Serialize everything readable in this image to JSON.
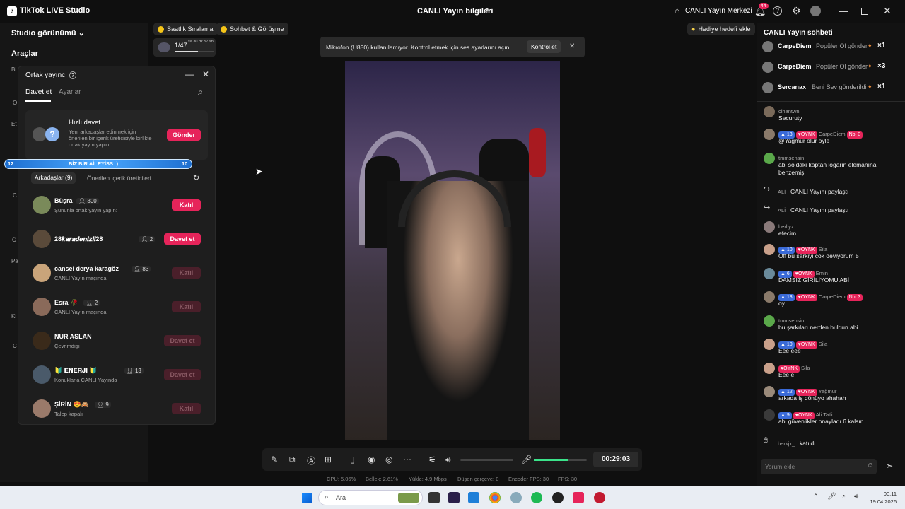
{
  "app": {
    "title": "TikTok LIVE Studio",
    "center_title": "CANLI Yayın bilgileri",
    "live_center": "CANLI Yayın Merkezi",
    "notif_count": "44"
  },
  "left": {
    "studio_view": "Studio görünümü",
    "tools": "Araçlar",
    "clipped_labels": [
      "Bi",
      "O",
      "Et",
      "C",
      "Ö",
      "Pa",
      "Ki",
      "C"
    ]
  },
  "top_pills": {
    "ranking": "Saatlik Sıralama",
    "chat_call": "Sohbet & Görüşme",
    "gift_goal": "Hediye hedefi ekle"
  },
  "goal_widget": {
    "progress_text": "1/47",
    "time_left": "sa 30 dk 57 sn",
    "progress_fraction": 0.6
  },
  "toast": {
    "message": "Mikrofon (U850) kullanılamıyor. Kontrol etmek için ses ayarlarını açın.",
    "button": "Kontrol et"
  },
  "modal": {
    "title": "Ortak yayıncı",
    "tabs": [
      "Davet et",
      "Ayarlar"
    ],
    "quick_invite": {
      "title": "Hızlı davet",
      "desc": "Yeni arkadaşlar edinmek için önerilen bir içerik üreticisiyle birlikte ortak yayın yapın",
      "button": "Gönder"
    },
    "banner": {
      "left": "12",
      "text": "BİZ BİR AİLEYİSS :)",
      "right": "10"
    },
    "subtabs": [
      "Arkadaşlar (9)",
      "Önerilen içerik üreticileri"
    ],
    "friends": [
      {
        "name": "Büşra",
        "count": "300",
        "sub": "Şununla ortak yayın yapın:",
        "button": "Katıl",
        "active": true
      },
      {
        "name": "28𝒌𝒂𝒓𝒂𝒅𝒆𝒏𝒊𝒛𝒍𝒊28",
        "count": "2",
        "sub": "",
        "button": "Davet et",
        "active": true
      },
      {
        "name": "cansel derya karagöz",
        "count": "83",
        "sub": "CANLI Yayın maçında",
        "button": "Katıl",
        "active": false
      },
      {
        "name": "Esra 🥀",
        "count": "2",
        "sub": "CANLI Yayın maçında",
        "button": "Katıl",
        "active": false
      },
      {
        "name": "NUR ASLAN",
        "count": "",
        "sub": "Çevrimdışı",
        "button": "Davet et",
        "active": false
      },
      {
        "name": "🔰 𝐄𝐍𝐄𝐑𝐉𝐈 🔰",
        "count": "13",
        "sub": "Konuklarla CANLI Yayında",
        "button": "Davet et",
        "active": false
      },
      {
        "name": "ŞİRİN 😍🙈",
        "count": "9",
        "sub": "Talep kapalı",
        "button": "Katıl",
        "active": false
      }
    ]
  },
  "controls": {
    "timer": "00:29:03",
    "volume_level": 0.0,
    "mic_level": 0.65
  },
  "status": {
    "cpu": "CPU: 5.06%",
    "mem": "Bellek: 2.61%",
    "upload": "Yükle: 4.9 Mbps",
    "dropped": "Düşen çerçeve: 0",
    "encoder_fps": "Encoder FPS: 30",
    "fps": "FPS: 30"
  },
  "chat": {
    "title": "CANLI Yayın sohbeti",
    "gifts": [
      {
        "name": "CarpeDiem",
        "text": "Popüler Ol gönder",
        "mult": "×1"
      },
      {
        "name": "CarpeDiem",
        "text": "Popüler Ol gönder",
        "mult": "×3"
      },
      {
        "name": "Sercanax",
        "text": "Beni Sev gönderildi",
        "mult": "×1"
      }
    ],
    "messages": [
      {
        "name": "cihantwn",
        "level": "",
        "fan": "",
        "rank": "",
        "text": "Securuty",
        "color": "#7a6a5a"
      },
      {
        "name": "CarpeDiem",
        "level": "13",
        "fan": "OYNK",
        "rank": "No. 3",
        "text": "@Yağmur olur öyle",
        "color": "#8a7a6a"
      },
      {
        "name": "tmmsensin",
        "level": "",
        "fan": "",
        "rank": "",
        "text": "abi soldaki kaptan logarın elemanına benzemiş",
        "color": "#5aa84a"
      },
      {
        "name": "ALİ",
        "level": "",
        "fan": "",
        "rank": "",
        "text": "CANLI Yayını paylaştı",
        "color": "share"
      },
      {
        "name": "ALİ",
        "level": "",
        "fan": "",
        "rank": "",
        "text": "CANLI Yayını paylaştı",
        "color": "share"
      },
      {
        "name": "berliyz",
        "level": "",
        "fan": "",
        "rank": "",
        "text": "efecim",
        "color": "#8a7a7a"
      },
      {
        "name": "Sila",
        "level": "10",
        "fan": "OYNK",
        "rank": "",
        "text": "Off bu sarkiyi cok deviyorum 5",
        "color": "#c9a08a"
      },
      {
        "name": "Emin",
        "level": "6",
        "fan": "OYNK",
        "rank": "",
        "text": "DAMSIZ GİRİLİYOMU ABİ",
        "color": "#6a8a9a"
      },
      {
        "name": "CarpeDiem",
        "level": "13",
        "fan": "OYNK",
        "rank": "No. 3",
        "text": "oy",
        "color": "#8a7a6a"
      },
      {
        "name": "tmmsensin",
        "level": "",
        "fan": "",
        "rank": "",
        "text": "bu şarkıları nerden buldun abi",
        "color": "#5aa84a"
      },
      {
        "name": "Sila",
        "level": "10",
        "fan": "OYNK",
        "rank": "",
        "text": "Eee eee",
        "color": "#c9a08a"
      },
      {
        "name": "Sila",
        "level": "",
        "fan": "OYNK",
        "rank": "",
        "text": "Eee e",
        "color": "#c9a08a"
      },
      {
        "name": "Yağmur",
        "level": "12",
        "fan": "OYNK",
        "rank": "",
        "text": "arkada iş dönüyo ahahah",
        "color": "#9a8a7a"
      },
      {
        "name": "Ali.Tatli",
        "level": "9",
        "fan": "OYNK",
        "rank": "",
        "text": "abi güvenlikler onayladı 6 kalsın",
        "color": "#3a3a3a"
      },
      {
        "name": "berkjx_",
        "level": "",
        "fan": "",
        "rank": "",
        "text": "katıldı",
        "color": "join"
      }
    ],
    "input_placeholder": "Yorum ekle"
  },
  "taskbar": {
    "search": "Ara",
    "time": "00:11",
    "date": "19.04.2026"
  }
}
